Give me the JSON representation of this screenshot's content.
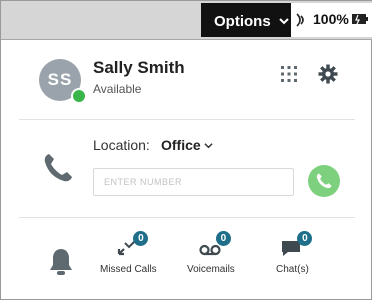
{
  "system_bar": {
    "options_label": "Options",
    "battery_text": "100%"
  },
  "profile": {
    "initials": "SS",
    "name": "Sally Smith",
    "status": "Available",
    "presence_color": "#3ab54a"
  },
  "dialer": {
    "location_label": "Location:",
    "location_value": "Office",
    "number_placeholder": "ENTER NUMBER",
    "number_value": ""
  },
  "features": {
    "missed_calls": {
      "label": "Missed Calls",
      "count": "0",
      "icon": "missed-call-icon"
    },
    "voicemails": {
      "label": "Voicemails",
      "count": "0",
      "icon": "voicemail-icon"
    },
    "chats": {
      "label": "Chat(s)",
      "count": "0",
      "icon": "chat-icon"
    }
  },
  "colors": {
    "accent_badge": "#1f6f8b",
    "call_button": "#7cd07e",
    "icon_gray": "#5f6a70"
  }
}
